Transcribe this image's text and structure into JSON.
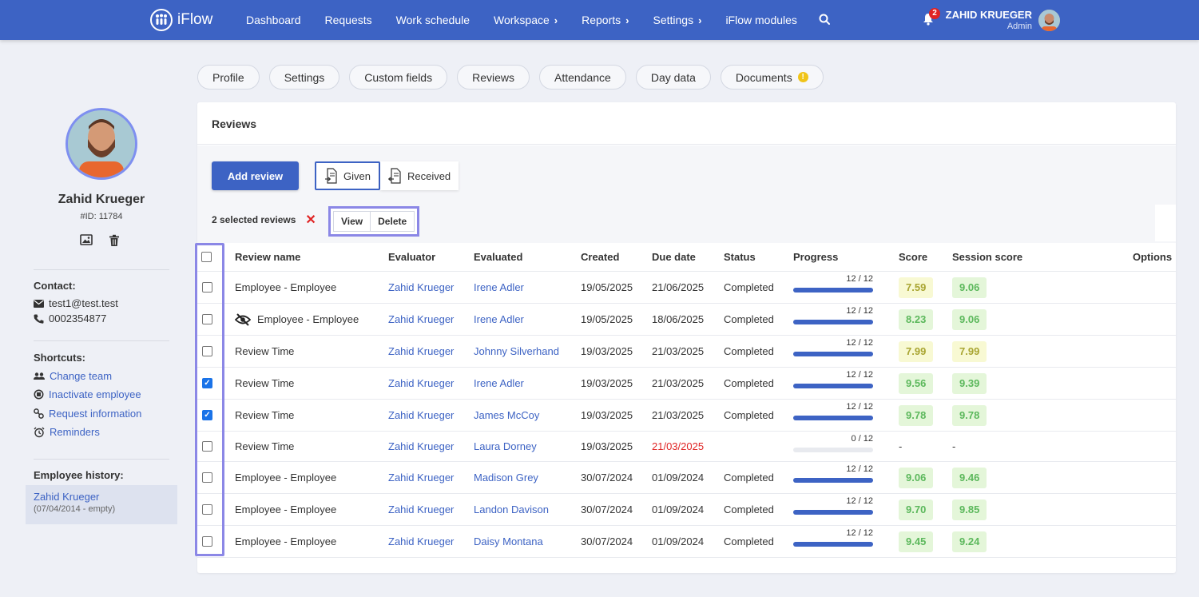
{
  "app": {
    "name": "iFlow"
  },
  "nav": {
    "items": [
      {
        "label": "Dashboard",
        "chevron": false
      },
      {
        "label": "Requests",
        "chevron": false
      },
      {
        "label": "Work schedule",
        "chevron": false
      },
      {
        "label": "Workspace",
        "chevron": true
      },
      {
        "label": "Reports",
        "chevron": true
      },
      {
        "label": "Settings",
        "chevron": true
      },
      {
        "label": "iFlow modules",
        "chevron": false
      }
    ],
    "notification_count": "2",
    "user_name": "ZAHID KRUEGER",
    "user_role": "Admin"
  },
  "employee": {
    "name": "Zahid Krueger",
    "id": "#ID: 11784",
    "contact_title": "Contact:",
    "email": "test1@test.test",
    "phone": "0002354877",
    "shortcuts_title": "Shortcuts:",
    "shortcuts": [
      {
        "label": "Change team",
        "icon": "users-icon"
      },
      {
        "label": "Inactivate employee",
        "icon": "block-icon"
      },
      {
        "label": "Request information",
        "icon": "link-icon"
      },
      {
        "label": "Reminders",
        "icon": "alarm-icon"
      }
    ],
    "history_title": "Employee history:",
    "history_name": "Zahid Krueger",
    "history_date": "(07/04/2014 - empty)"
  },
  "tabs": [
    "Profile",
    "Settings",
    "Custom fields",
    "Reviews",
    "Attendance",
    "Day data",
    "Documents"
  ],
  "reviews": {
    "title": "Reviews",
    "add_label": "Add review",
    "given_label": "Given",
    "received_label": "Received",
    "selected_text": "2 selected reviews",
    "view_label": "View",
    "delete_label": "Delete",
    "columns": {
      "name": "Review name",
      "evaluator": "Evaluator",
      "evaluated": "Evaluated",
      "created": "Created",
      "due": "Due date",
      "status": "Status",
      "progress": "Progress",
      "score": "Score",
      "session": "Session score",
      "options": "Options"
    },
    "rows": [
      {
        "checked": false,
        "hidden": false,
        "name": "Employee - Employee",
        "evaluator": "Zahid Krueger",
        "evaluated": "Irene Adler",
        "created": "19/05/2025",
        "due": "21/06/2025",
        "overdue": false,
        "status": "Completed",
        "progress": "12 / 12",
        "progress_value": 1.0,
        "score": "7.59",
        "score_color": "yellow",
        "session": "9.06",
        "session_color": "green"
      },
      {
        "checked": false,
        "hidden": true,
        "name": "Employee - Employee",
        "evaluator": "Zahid Krueger",
        "evaluated": "Irene Adler",
        "created": "19/05/2025",
        "due": "18/06/2025",
        "overdue": false,
        "status": "Completed",
        "progress": "12 / 12",
        "progress_value": 1.0,
        "score": "8.23",
        "score_color": "green",
        "session": "9.06",
        "session_color": "green"
      },
      {
        "checked": false,
        "hidden": false,
        "name": "Review Time",
        "evaluator": "Zahid Krueger",
        "evaluated": "Johnny Silverhand",
        "created": "19/03/2025",
        "due": "21/03/2025",
        "overdue": false,
        "status": "Completed",
        "progress": "12 / 12",
        "progress_value": 1.0,
        "score": "7.99",
        "score_color": "yellow",
        "session": "7.99",
        "session_color": "yellow"
      },
      {
        "checked": true,
        "hidden": false,
        "name": "Review Time",
        "evaluator": "Zahid Krueger",
        "evaluated": "Irene Adler",
        "created": "19/03/2025",
        "due": "21/03/2025",
        "overdue": false,
        "status": "Completed",
        "progress": "12 / 12",
        "progress_value": 1.0,
        "score": "9.56",
        "score_color": "green",
        "session": "9.39",
        "session_color": "green"
      },
      {
        "checked": true,
        "hidden": false,
        "name": "Review Time",
        "evaluator": "Zahid Krueger",
        "evaluated": "James McCoy",
        "created": "19/03/2025",
        "due": "21/03/2025",
        "overdue": false,
        "status": "Completed",
        "progress": "12 / 12",
        "progress_value": 1.0,
        "score": "9.78",
        "score_color": "green",
        "session": "9.78",
        "session_color": "green"
      },
      {
        "checked": false,
        "hidden": false,
        "name": "Review Time",
        "evaluator": "Zahid Krueger",
        "evaluated": "Laura Dorney",
        "created": "19/03/2025",
        "due": "21/03/2025",
        "overdue": true,
        "status": "",
        "progress": "0 / 12",
        "progress_value": 0.0,
        "score": "-",
        "score_color": "none",
        "session": "-",
        "session_color": "none"
      },
      {
        "checked": false,
        "hidden": false,
        "name": "Employee - Employee",
        "evaluator": "Zahid Krueger",
        "evaluated": "Madison Grey",
        "created": "30/07/2024",
        "due": "01/09/2024",
        "overdue": false,
        "status": "Completed",
        "progress": "12 / 12",
        "progress_value": 1.0,
        "score": "9.06",
        "score_color": "green",
        "session": "9.46",
        "session_color": "green"
      },
      {
        "checked": false,
        "hidden": false,
        "name": "Employee - Employee",
        "evaluator": "Zahid Krueger",
        "evaluated": "Landon Davison",
        "created": "30/07/2024",
        "due": "01/09/2024",
        "overdue": false,
        "status": "Completed",
        "progress": "12 / 12",
        "progress_value": 1.0,
        "score": "9.70",
        "score_color": "green",
        "session": "9.85",
        "session_color": "green"
      },
      {
        "checked": false,
        "hidden": false,
        "name": "Employee - Employee",
        "evaluator": "Zahid Krueger",
        "evaluated": "Daisy Montana",
        "created": "30/07/2024",
        "due": "01/09/2024",
        "overdue": false,
        "status": "Completed",
        "progress": "12 / 12",
        "progress_value": 1.0,
        "score": "9.45",
        "score_color": "green",
        "session": "9.24",
        "session_color": "green"
      }
    ]
  },
  "colors": {
    "brand": "#3d63c4",
    "highlight": "#8b87e6",
    "danger": "#e02424",
    "score_green": "#5cb85c",
    "score_yellow": "#a9a532"
  }
}
